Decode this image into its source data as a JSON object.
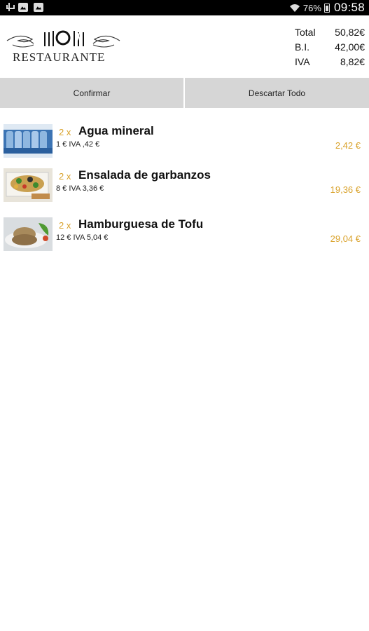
{
  "status_bar": {
    "battery": "76%",
    "time": "09:58"
  },
  "logo": {
    "text": "RESTAURANTE"
  },
  "totals": [
    {
      "label": "Total",
      "value": "50,82€"
    },
    {
      "label": "B.I.",
      "value": "42,00€"
    },
    {
      "label": "IVA",
      "value": "8,82€"
    }
  ],
  "actions": {
    "confirm": "Confirmar",
    "discard": "Descartar Todo"
  },
  "items": [
    {
      "qty": "2 x",
      "name": "Agua mineral",
      "detail": "1 € IVA ,42 €",
      "price": "2,42 €",
      "image": "water-bottles-image"
    },
    {
      "qty": "2 x",
      "name": "Ensalada de garbanzos",
      "detail": "8 € IVA 3,36 €",
      "price": "19,36 €",
      "image": "chickpea-salad-image"
    },
    {
      "qty": "2 x",
      "name": "Hamburguesa de Tofu",
      "detail": "12 € IVA 5,04 €",
      "price": "29,04 €",
      "image": "tofu-burger-image"
    }
  ]
}
